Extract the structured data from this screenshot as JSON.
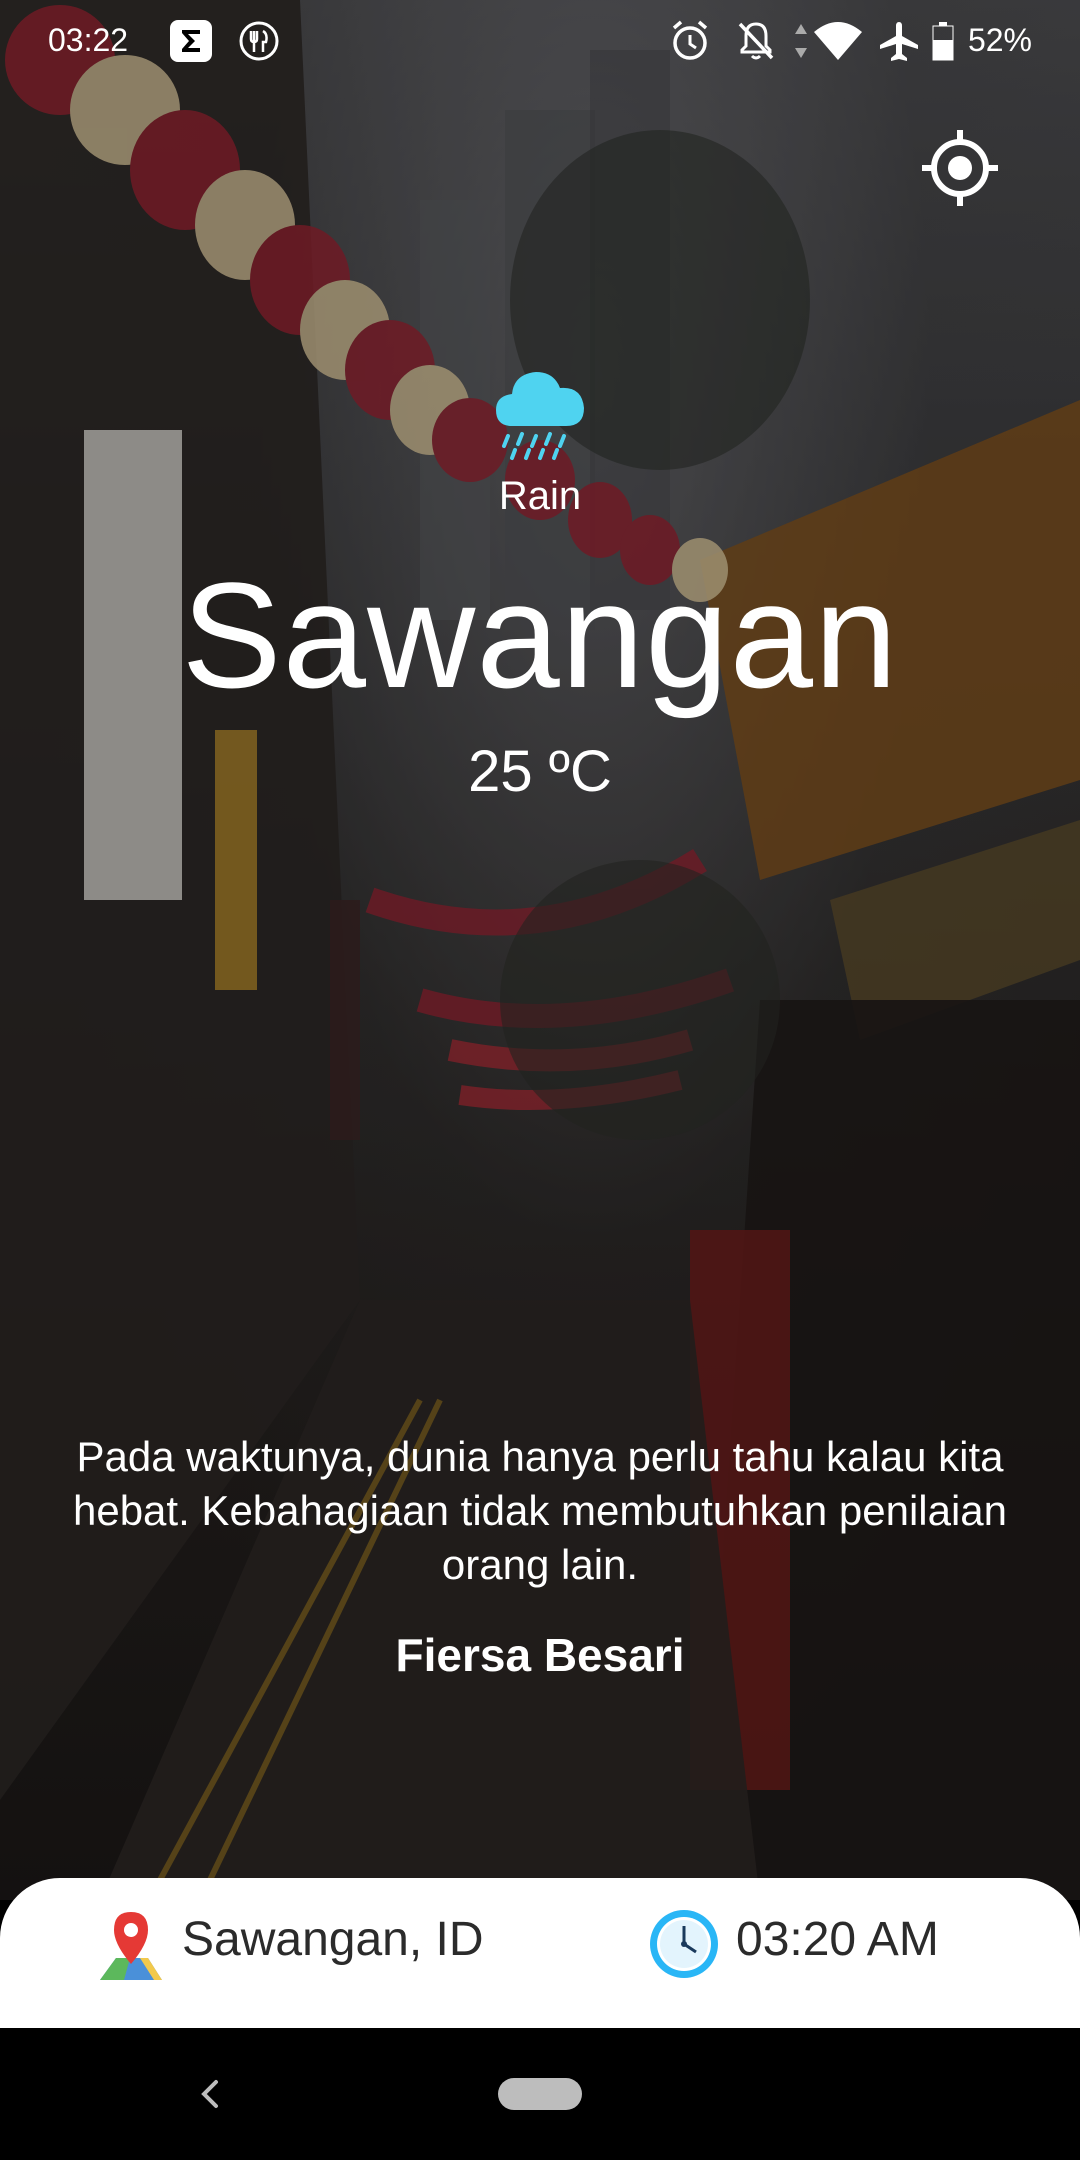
{
  "status_bar": {
    "time": "03:22",
    "battery": "52%",
    "icons": [
      "sigma-app-icon",
      "food-app-icon",
      "alarm-icon",
      "notifications-off-icon",
      "data-arrows-icon",
      "wifi-icon",
      "airplane-icon",
      "battery-icon"
    ]
  },
  "weather": {
    "condition": "Rain",
    "city": "Sawangan",
    "temperature": "25 ºC",
    "icon": "rain-cloud-icon",
    "icon_color": "#4fd3f0"
  },
  "quote": {
    "text": "Pada waktunya, dunia hanya perlu tahu kalau kita hebat. Kebahagiaan tidak membutuhkan penilaian orang lain.",
    "author": "Fiersa Besari"
  },
  "info_card": {
    "location": "Sawangan, ID",
    "time": "03:20 AM",
    "location_icon": "map-pin-icon",
    "clock_icon": "clock-icon"
  },
  "actions": {
    "locate_icon": "my-location-icon"
  },
  "nav": {
    "back_icon": "back-chevron-icon",
    "home_icon": "home-pill-icon"
  }
}
